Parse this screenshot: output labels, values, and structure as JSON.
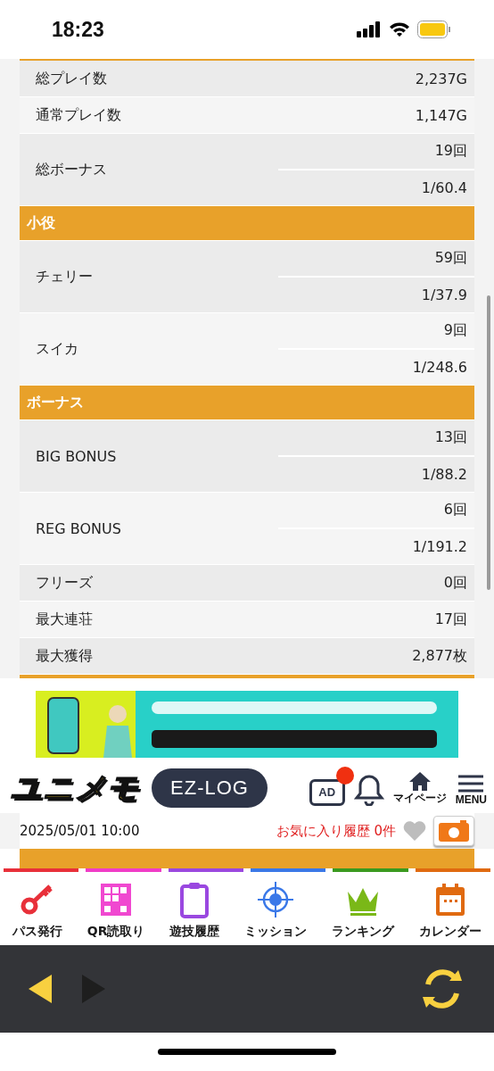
{
  "status_bar": {
    "time": "18:23"
  },
  "stats": [
    {
      "kind": "single",
      "label": "総プレイ数",
      "values": [
        "2,237G"
      ]
    },
    {
      "kind": "single",
      "label": "通常プレイ数",
      "values": [
        "1,147G"
      ]
    },
    {
      "kind": "double",
      "label": "総ボーナス",
      "values": [
        "19回",
        "1/60.4"
      ]
    },
    {
      "kind": "header",
      "label": "小役"
    },
    {
      "kind": "double",
      "label": "チェリー",
      "values": [
        "59回",
        "1/37.9"
      ]
    },
    {
      "kind": "double",
      "label": "スイカ",
      "values": [
        "9回",
        "1/248.6"
      ]
    },
    {
      "kind": "header",
      "label": "ボーナス"
    },
    {
      "kind": "double",
      "label": "BIG BONUS",
      "values": [
        "13回",
        "1/88.2"
      ]
    },
    {
      "kind": "double",
      "label": "REG BONUS",
      "values": [
        "6回",
        "1/191.2"
      ]
    },
    {
      "kind": "single",
      "label": "フリーズ",
      "values": [
        "0回"
      ]
    },
    {
      "kind": "single",
      "label": "最大連荘",
      "values": [
        "17回"
      ]
    },
    {
      "kind": "single",
      "label": "最大獲得",
      "values": [
        "2,877枚"
      ]
    }
  ],
  "header": {
    "logo": "ユニメモ",
    "log_button": "EZ-LOG",
    "ad_badge": "AD",
    "notification_dot": true,
    "mypage": "マイページ",
    "menu": "MENU"
  },
  "info_row": {
    "date": "2025/05/01 10:00",
    "favorites": "お気に入り履歴 0件",
    "favorited": false
  },
  "tabs": [
    {
      "label": "パス発行",
      "color": "#e8303a"
    },
    {
      "label": "QR読取り",
      "color": "#f03cc8"
    },
    {
      "label": "遊技履歴",
      "color": "#9a48e0"
    },
    {
      "label": "ミッション",
      "color": "#3a78e8"
    },
    {
      "label": "ランキング",
      "color": "#3a9a20"
    },
    {
      "label": "カレンダー",
      "color": "#e06a10"
    }
  ],
  "nav": {
    "back": {
      "disabled": false
    },
    "forward": {
      "disabled": true
    }
  }
}
